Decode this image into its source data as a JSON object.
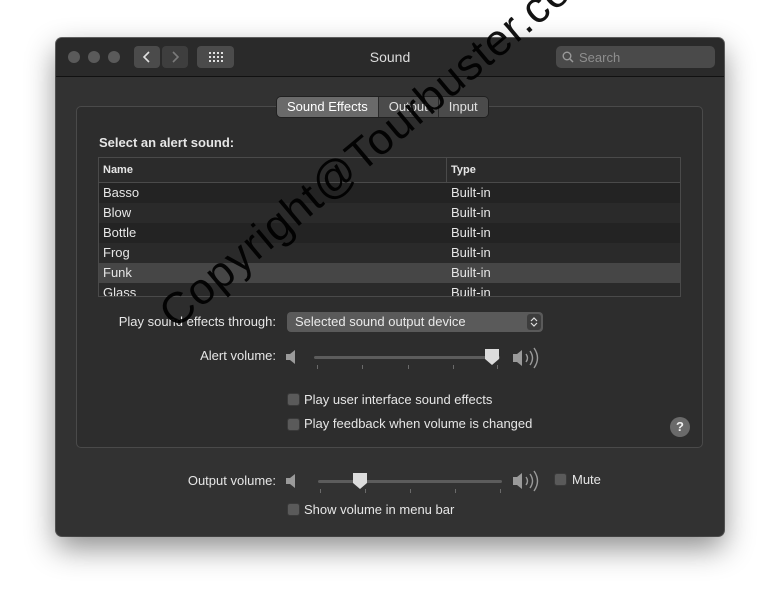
{
  "window": {
    "title": "Sound",
    "search_placeholder": "Search",
    "accent": "#6a6a6a"
  },
  "tabs": [
    {
      "label": "Sound Effects",
      "active": true
    },
    {
      "label": "Output",
      "active": false
    },
    {
      "label": "Input",
      "active": false
    }
  ],
  "sound_effects": {
    "heading": "Select an alert sound:",
    "columns": [
      "Name",
      "Type"
    ],
    "rows": [
      {
        "name": "Basso",
        "type": "Built-in"
      },
      {
        "name": "Blow",
        "type": "Built-in"
      },
      {
        "name": "Bottle",
        "type": "Built-in"
      },
      {
        "name": "Frog",
        "type": "Built-in"
      },
      {
        "name": "Funk",
        "type": "Built-in",
        "selected": true
      },
      {
        "name": "Glass",
        "type": "Built-in"
      }
    ],
    "play_through_label": "Play sound effects through:",
    "play_through_value": "Selected sound output device",
    "alert_volume_label": "Alert volume:",
    "alert_volume_level": 1.0,
    "ui_sounds_label": "Play user interface sound effects",
    "ui_sounds_checked": false,
    "feedback_label": "Play feedback when volume is changed",
    "feedback_checked": false,
    "help_label": "?"
  },
  "output": {
    "volume_label": "Output volume:",
    "volume_level": 0.2,
    "mute_label": "Mute",
    "mute_checked": false,
    "menu_bar_label": "Show volume in menu bar",
    "menu_bar_checked": false
  },
  "watermark": "Copyright@Tourbuster.com"
}
